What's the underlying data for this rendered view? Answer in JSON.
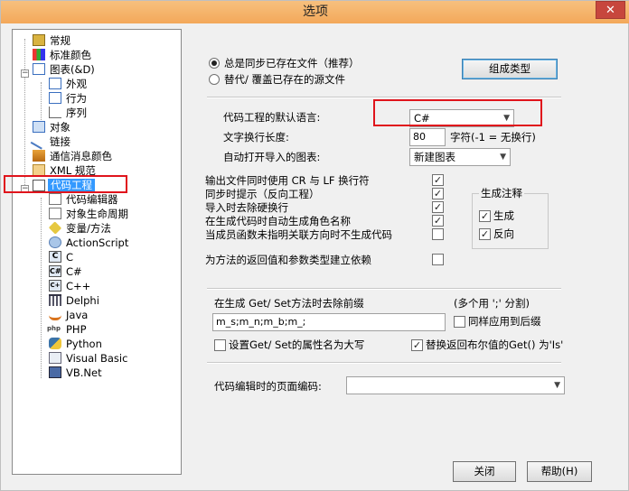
{
  "window": {
    "title": "选项",
    "close_label": "✕"
  },
  "tree": {
    "items": [
      {
        "label": "常规"
      },
      {
        "label": "标准颜色"
      },
      {
        "label": "图表(&D)"
      },
      {
        "label": "外观"
      },
      {
        "label": "行为"
      },
      {
        "label": "序列"
      },
      {
        "label": "对象"
      },
      {
        "label": "链接"
      },
      {
        "label": "通信消息颜色"
      },
      {
        "label": "XML 规范"
      },
      {
        "label": "代码工程"
      },
      {
        "label": "代码编辑器"
      },
      {
        "label": "对象生命周期"
      },
      {
        "label": "变量/方法"
      },
      {
        "label": "ActionScript"
      },
      {
        "label": "C"
      },
      {
        "label": "C#"
      },
      {
        "label": "C++"
      },
      {
        "label": "Delphi"
      },
      {
        "label": "Java"
      },
      {
        "label": "PHP"
      },
      {
        "label": "Python"
      },
      {
        "label": "Visual Basic"
      },
      {
        "label": "VB.Net"
      }
    ]
  },
  "panel": {
    "radio_sync": "总是同步已存在文件（推荐）",
    "radio_overwrite": "替代/ 覆盖已存在的源文件",
    "group_types_button": "组成类型",
    "default_language_label": "代码工程的默认语言:",
    "default_language_value": "C#",
    "wrap_length_label": "文字换行长度:",
    "wrap_length_value": "80",
    "wrap_length_hint": "字符(-1 = 无换行)",
    "open_imported_label": "自动打开导入的图表:",
    "open_imported_value": "新建图表",
    "options": [
      {
        "label": "输出文件同时使用 CR 与 LF 换行符",
        "checked": true
      },
      {
        "label": "同步时提示（反向工程）",
        "checked": true
      },
      {
        "label": "导入时去除硬换行",
        "checked": true
      },
      {
        "label": "在生成代码时自动生成角色名称",
        "checked": true
      },
      {
        "label": "当成员函数未指明关联方向时不生成代码",
        "checked": false
      }
    ],
    "return_dependency_label": "为方法的返回值和参数类型建立依赖",
    "gen_notes": {
      "title": "生成注释",
      "generate": "生成",
      "reverse": "反向"
    },
    "prefix_label": "在生成 Get/ Set方法时去除前缀",
    "prefix_hint": "(多个用 ';' 分割)",
    "prefix_value": "m_s;m_n;m_b;m_;",
    "apply_suffix_label": "同样应用到后缀",
    "capitalize_label": "设置Get/ Set的属性名为大写",
    "replace_bool_label": "替换返回布尔值的Get() 为'Is'",
    "page_encoding_label": "代码编辑时的页面编码:",
    "page_encoding_value": ""
  },
  "footer": {
    "close_button": "关闭",
    "help_button": "帮助(H)"
  },
  "colors": {
    "highlight_red": "#e0141c",
    "selection_blue": "#3399ff",
    "titlebar": "#f3a85a"
  }
}
